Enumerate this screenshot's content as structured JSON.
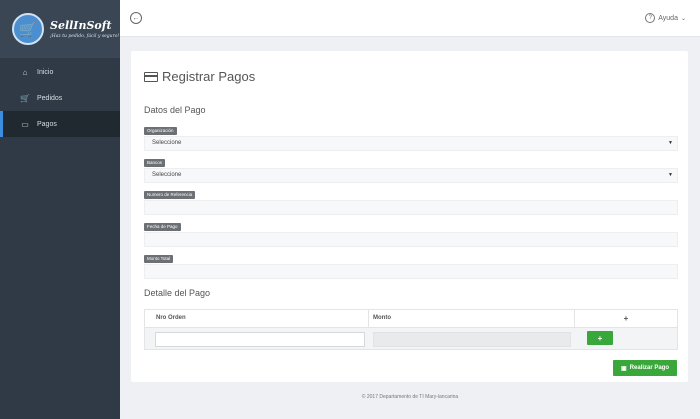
{
  "app": {
    "name": "SellInSoft",
    "tagline": "¡Haz tu pedido, fácil y seguro!"
  },
  "sidebar": {
    "items": [
      {
        "label": "Inicio",
        "icon": "home-icon"
      },
      {
        "label": "Pedidos",
        "icon": "cart-icon"
      },
      {
        "label": "Pagos",
        "icon": "credit-card-icon",
        "active": true
      }
    ]
  },
  "topbar": {
    "help_label": "Ayuda"
  },
  "page": {
    "title": "Registrar Pagos",
    "section_payment": "Datos del Pago",
    "section_detail": "Detalle del Pago"
  },
  "form": {
    "organizacion_label": "Organización",
    "organizacion_value": "Seleccione",
    "bancos_label": "Bancos",
    "bancos_value": "Seleccione",
    "referencia_label": "Numero de Referencia",
    "fecha_label": "Fecha de Pago",
    "monto_total_label": "Monto Total"
  },
  "table": {
    "columns": [
      "Nro Orden",
      "Monto",
      "+"
    ],
    "add_button": "+"
  },
  "actions": {
    "submit_label": "Realizar Pago"
  },
  "footer": {
    "text": "© 2017 Departamento de TI Mary-lancarina"
  },
  "colors": {
    "sidebar": "#2f3a46",
    "active_accent": "#3c8dde",
    "success": "#3aa73a"
  }
}
